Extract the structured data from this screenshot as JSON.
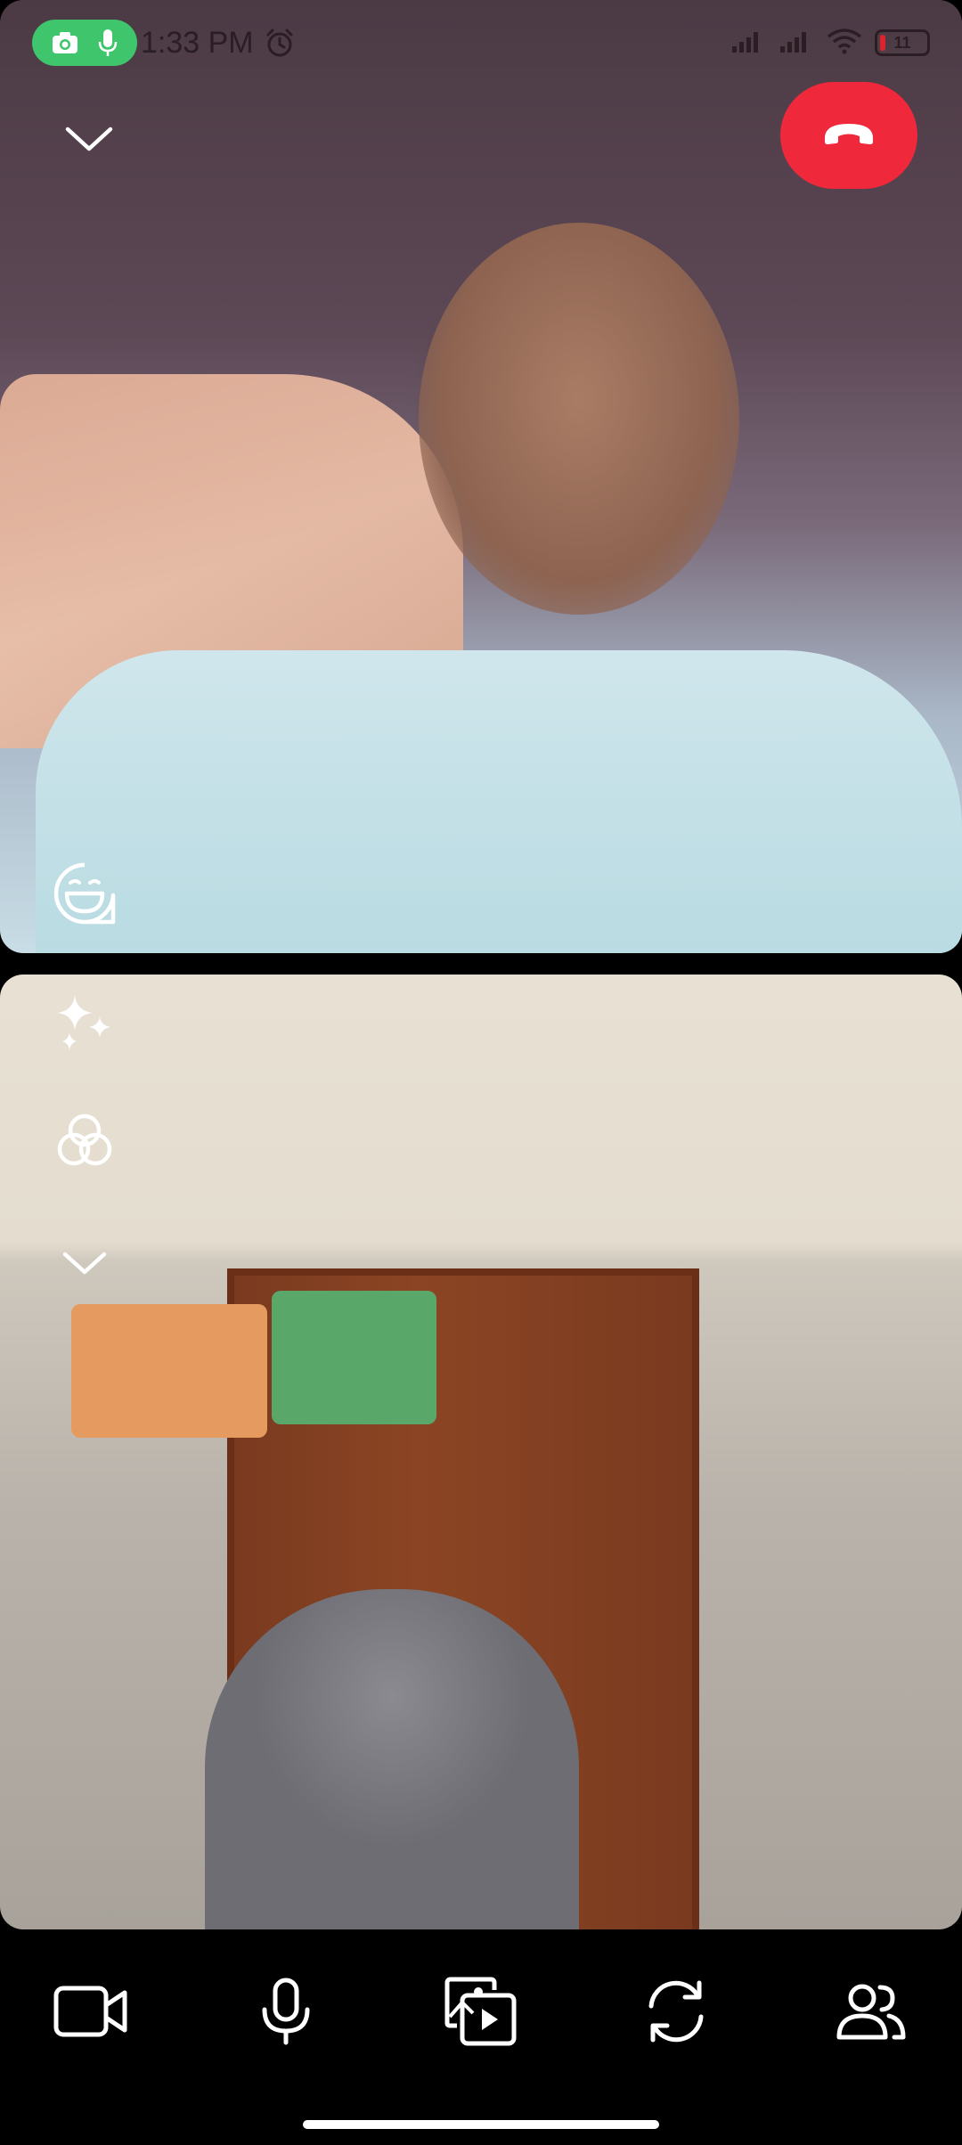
{
  "status_bar": {
    "time": "1:33 PM",
    "battery_level": "11",
    "battery_fraction": 0.11,
    "pill_icons": [
      "camera-icon",
      "microphone-icon"
    ],
    "right_icons": [
      "signal-icon",
      "signal-icon",
      "wifi-icon",
      "battery-icon"
    ],
    "pill_color": "#3fc56b"
  },
  "call": {
    "end_call_color": "#f0283c",
    "top_overlay_icons": [
      "chevron-down-icon",
      "end-call-icon",
      "reaction-icon"
    ],
    "bottom_overlay_icons": [
      "sparkles-effects-icon",
      "filters-icon",
      "chevron-down-icon"
    ]
  },
  "controls": {
    "items": [
      {
        "name": "video-camera-icon"
      },
      {
        "name": "microphone-icon"
      },
      {
        "name": "media-share-icon"
      },
      {
        "name": "flip-camera-icon"
      },
      {
        "name": "participants-icon"
      }
    ]
  }
}
